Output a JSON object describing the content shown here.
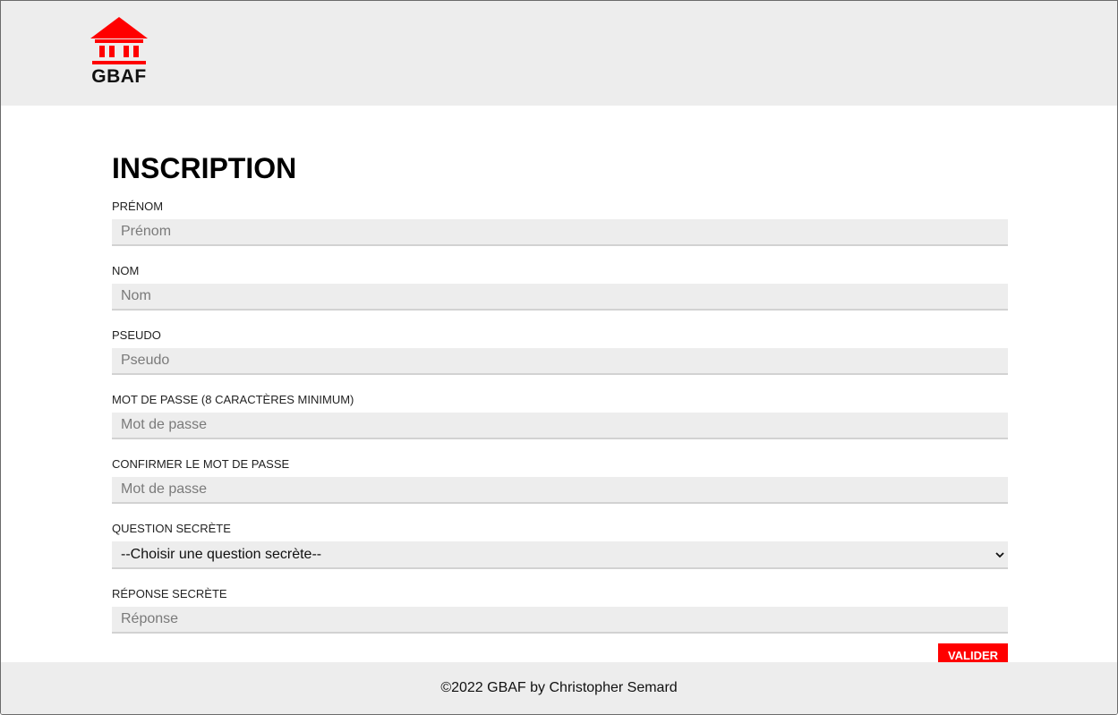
{
  "header": {
    "logo_text": "GBAF",
    "brand_color": "#ff0000"
  },
  "form": {
    "title": "INSCRIPTION",
    "fields": [
      {
        "label": "PRÉNOM",
        "placeholder": "Prénom",
        "value": ""
      },
      {
        "label": "NOM",
        "placeholder": "Nom",
        "value": ""
      },
      {
        "label": "PSEUDO",
        "placeholder": "Pseudo",
        "value": ""
      },
      {
        "label": "MOT DE PASSE (8 CARACTÈRES MINIMUM)",
        "placeholder": "Mot de passe",
        "value": ""
      },
      {
        "label": "CONFIRMER LE MOT DE PASSE",
        "placeholder": "Mot de passe",
        "value": ""
      }
    ],
    "question": {
      "label": "QUESTION SECRÈTE",
      "selected": "--Choisir une question secrète--"
    },
    "answer": {
      "label": "RÉPONSE SECRÈTE",
      "placeholder": "Réponse",
      "value": ""
    },
    "submit_label": "VALIDER"
  },
  "footer": {
    "text": "©2022 GBAF by Christopher Semard"
  }
}
